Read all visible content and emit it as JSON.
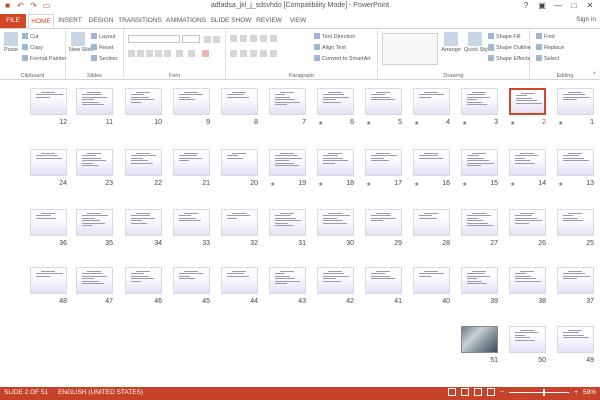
{
  "app": {
    "title": "adfadsa_jkl_j_sdsvhdo [Compatibility Mode] - PowerPoint",
    "sign_in": "Sign in",
    "qat_icons": [
      "save-icon",
      "undo-icon",
      "redo-icon",
      "slideshow-icon"
    ]
  },
  "tabs": [
    "FILE",
    "HOME",
    "INSERT",
    "DESIGN",
    "TRANSITIONS",
    "ANIMATIONS",
    "SLIDE SHOW",
    "REVIEW",
    "VIEW"
  ],
  "active_tab": "HOME",
  "ribbon": {
    "clipboard": {
      "label": "Clipboard",
      "paste": "Paste",
      "cut": "Cut",
      "copy": "Copy",
      "format_painter": "Format Painter"
    },
    "slides": {
      "label": "Slides",
      "new_slide": "New Slide",
      "layout": "Layout",
      "reset": "Reset",
      "section": "Section"
    },
    "font": {
      "label": "Font"
    },
    "paragraph": {
      "label": "Paragraph",
      "text_direction": "Text Direction",
      "align_text": "Align Text",
      "convert_smartart": "Convert to SmartArt"
    },
    "drawing": {
      "label": "Drawing",
      "arrange": "Arrange",
      "quick_styles": "Quick Styles",
      "shape_fill": "Shape Fill",
      "shape_outline": "Shape Outline",
      "shape_effects": "Shape Effects"
    },
    "editing": {
      "label": "Editing",
      "find": "Find",
      "replace": "Replace",
      "select": "Select"
    }
  },
  "slides": {
    "rows": [
      {
        "numbers": [
          "12",
          "11",
          "10",
          "9",
          "8",
          "7",
          "6",
          "5",
          "4",
          "3",
          "2",
          "1"
        ],
        "starred": [
          "6",
          "5",
          "4",
          "3",
          "2",
          "1"
        ]
      },
      {
        "numbers": [
          "24",
          "23",
          "22",
          "21",
          "20",
          "19",
          "18",
          "17",
          "16",
          "15",
          "14",
          "13"
        ],
        "starred": [
          "19",
          "18",
          "17",
          "16",
          "15",
          "14",
          "13"
        ]
      },
      {
        "numbers": [
          "36",
          "35",
          "34",
          "33",
          "32",
          "31",
          "30",
          "29",
          "28",
          "27",
          "26",
          "25"
        ],
        "starred": []
      },
      {
        "numbers": [
          "48",
          "47",
          "46",
          "45",
          "44",
          "43",
          "42",
          "41",
          "40",
          "39",
          "38",
          "37"
        ],
        "starred": []
      },
      {
        "numbers": [
          "51",
          "50",
          "49"
        ],
        "starred": []
      }
    ],
    "selected": "2",
    "photo_slide": "51"
  },
  "status": {
    "slide_info": "SLIDE 2 OF 51",
    "language": "ENGLISH (UNITED STATES)",
    "zoom": "59%",
    "zoom_level": 0.59
  },
  "colors": {
    "accent": "#d24726",
    "status_bar": "#c7422a"
  }
}
